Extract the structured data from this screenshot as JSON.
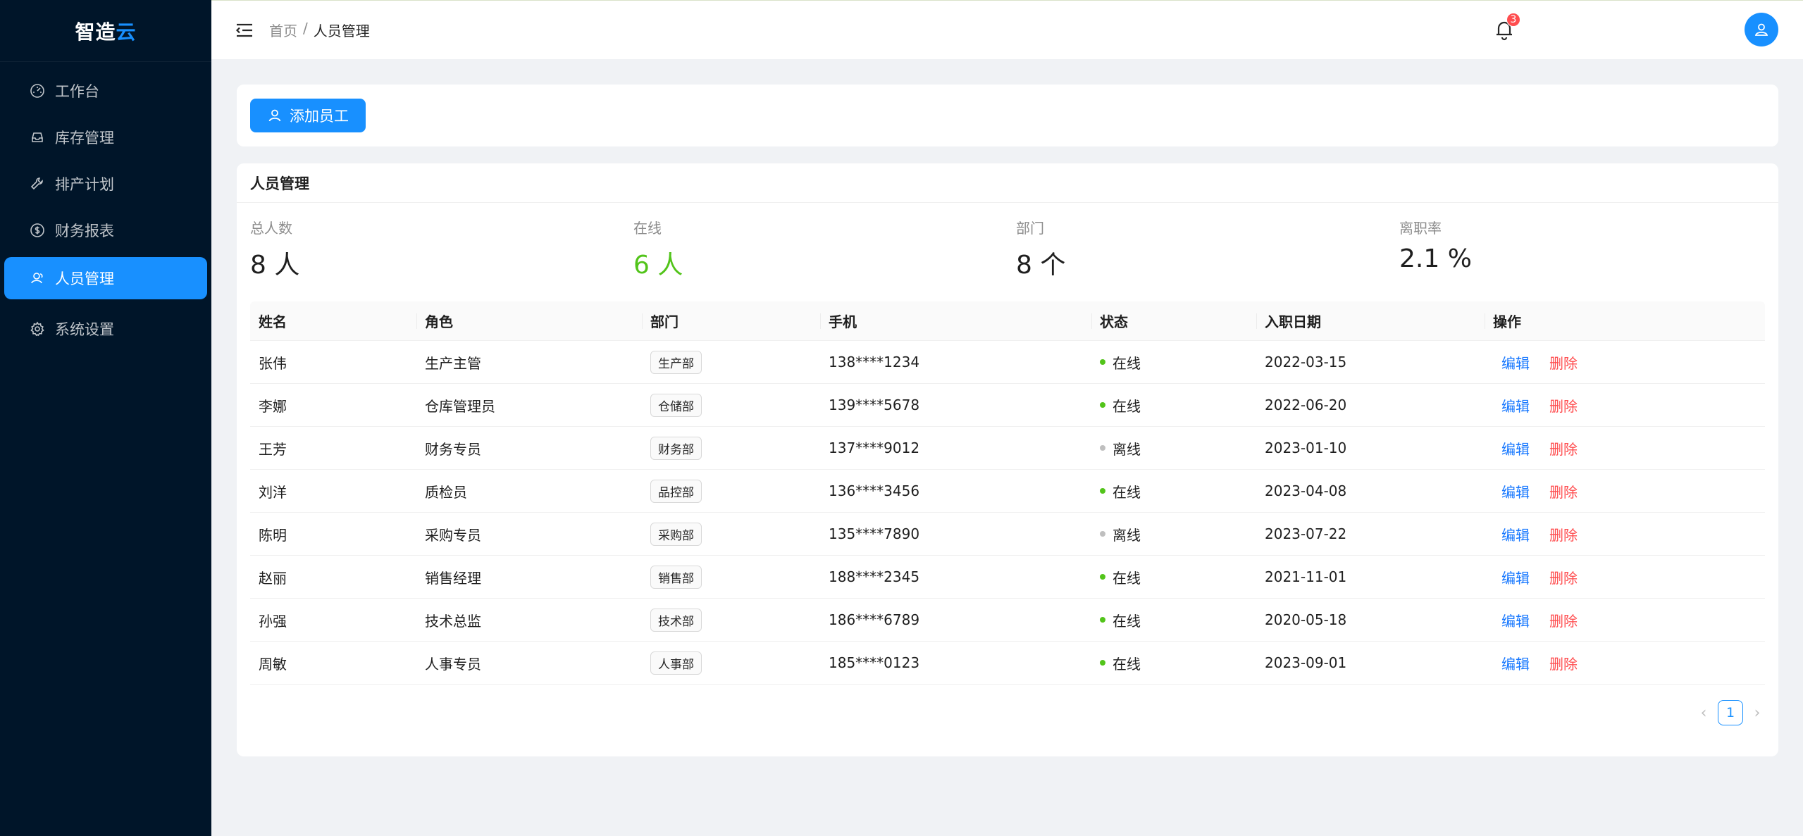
{
  "brand": {
    "name_main": "智造",
    "name_accent": "云"
  },
  "sidebar": {
    "items": [
      {
        "label": "工作台",
        "icon": "dashboard-icon"
      },
      {
        "label": "库存管理",
        "icon": "inbox-icon"
      },
      {
        "label": "排产计划",
        "icon": "tool-icon"
      },
      {
        "label": "财务报表",
        "icon": "dollar-icon"
      },
      {
        "label": "人员管理",
        "icon": "user-icon",
        "active": true
      },
      {
        "label": "系统设置",
        "icon": "gear-icon"
      }
    ]
  },
  "header": {
    "breadcrumb": {
      "home": "首页",
      "separator": "/",
      "current": "人员管理"
    },
    "notification_count": "3"
  },
  "toolbar": {
    "add_label": "添加员工"
  },
  "main": {
    "title": "人员管理",
    "stats": [
      {
        "label": "总人数",
        "value": "8 人"
      },
      {
        "label": "在线",
        "value": "6 人"
      },
      {
        "label": "部门",
        "value": "8 个"
      },
      {
        "label": "离职率",
        "value": "2.1 %"
      }
    ],
    "table": {
      "columns": [
        "姓名",
        "角色",
        "部门",
        "手机",
        "状态",
        "入职日期",
        "操作"
      ],
      "edit_label": "编辑",
      "delete_label": "删除",
      "rows": [
        {
          "name": "张伟",
          "role": "生产主管",
          "dept": "生产部",
          "phone": "138****1234",
          "status": "在线",
          "date": "2022-03-15"
        },
        {
          "name": "李娜",
          "role": "仓库管理员",
          "dept": "仓储部",
          "phone": "139****5678",
          "status": "在线",
          "date": "2022-06-20"
        },
        {
          "name": "王芳",
          "role": "财务专员",
          "dept": "财务部",
          "phone": "137****9012",
          "status": "离线",
          "date": "2023-01-10"
        },
        {
          "name": "刘洋",
          "role": "质检员",
          "dept": "品控部",
          "phone": "136****3456",
          "status": "在线",
          "date": "2023-04-08"
        },
        {
          "name": "陈明",
          "role": "采购专员",
          "dept": "采购部",
          "phone": "135****7890",
          "status": "离线",
          "date": "2023-07-22"
        },
        {
          "name": "赵丽",
          "role": "销售经理",
          "dept": "销售部",
          "phone": "188****2345",
          "status": "在线",
          "date": "2021-11-01"
        },
        {
          "name": "孙强",
          "role": "技术总监",
          "dept": "技术部",
          "phone": "186****6789",
          "status": "在线",
          "date": "2020-05-18"
        },
        {
          "name": "周敏",
          "role": "人事专员",
          "dept": "人事部",
          "phone": "185****0123",
          "status": "在线",
          "date": "2023-09-01"
        }
      ]
    },
    "pagination": {
      "current": "1",
      "prev": "‹",
      "next": "›"
    }
  },
  "colors": {
    "primary": "#1890ff",
    "sidebar_bg": "#001529",
    "online": "#52c41a",
    "offline": "#bfbfbf",
    "danger": "#ff4d4f"
  }
}
